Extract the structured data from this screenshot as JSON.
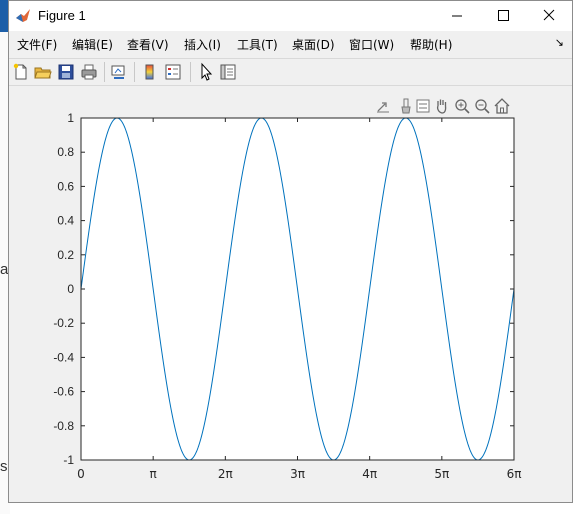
{
  "window": {
    "title": "Figure 1"
  },
  "background": {
    "fragment_a": "a",
    "fragment_s": "s"
  },
  "menu": {
    "items": [
      {
        "label": "文件(F)"
      },
      {
        "label": "编辑(E)"
      },
      {
        "label": "查看(V)"
      },
      {
        "label": "插入(I)"
      },
      {
        "label": "工具(T)"
      },
      {
        "label": "桌面(D)"
      },
      {
        "label": "窗口(W)"
      },
      {
        "label": "帮助(H)"
      }
    ],
    "overflow_glyph": "↘"
  },
  "toolbar": {
    "icons": [
      "new-figure-icon",
      "open-file-icon",
      "save-icon",
      "print-icon",
      "link-plot-icon",
      "colorbar-icon",
      "legend-icon",
      "edit-plot-icon",
      "property-inspector-icon"
    ]
  },
  "axes_toolbar": {
    "icons": [
      "export-icon",
      "brush-icon",
      "datatip-icon",
      "pan-icon",
      "zoom-in-icon",
      "zoom-out-icon",
      "home-icon"
    ]
  },
  "colors": {
    "line": "#0072BD",
    "window_bg": "#f0f0f0",
    "axes_bg": "#ffffff"
  },
  "chart_data": {
    "type": "line",
    "title": "",
    "xlabel": "",
    "ylabel": "",
    "function": "sin(x)",
    "xlim": [
      0,
      18.8496
    ],
    "ylim": [
      -1,
      1
    ],
    "x_ticks": [
      0,
      3.1416,
      6.2832,
      9.4248,
      12.5664,
      15.708,
      18.8496
    ],
    "x_tick_labels": [
      "0",
      "π",
      "2π",
      "3π",
      "4π",
      "5π",
      "6π"
    ],
    "y_ticks": [
      -1,
      -0.8,
      -0.6,
      -0.4,
      -0.2,
      0,
      0.2,
      0.4,
      0.6,
      0.8,
      1
    ],
    "y_tick_labels": [
      "-1",
      "-0.8",
      "-0.6",
      "-0.4",
      "-0.2",
      "0",
      "0.2",
      "0.4",
      "0.6",
      "0.8",
      "1"
    ],
    "grid": false,
    "series": [
      {
        "x": [
          0,
          0.7854,
          1.5708,
          2.3562,
          3.1416,
          3.927,
          4.7124,
          5.4978,
          6.2832,
          7.0686,
          7.854,
          8.6394,
          9.4248,
          10.2102,
          10.9956,
          11.781,
          12.5664,
          13.3518,
          14.1372,
          14.9226,
          15.708,
          16.4934,
          17.2788,
          18.0642,
          18.8496
        ],
        "values": [
          0,
          0.7071,
          1,
          0.7071,
          0,
          -0.7071,
          -1,
          -0.7071,
          0,
          0.7071,
          1,
          0.7071,
          0,
          -0.7071,
          -1,
          -0.7071,
          0,
          0.7071,
          1,
          0.7071,
          0,
          -0.7071,
          -1,
          -0.7071,
          0
        ]
      }
    ]
  }
}
